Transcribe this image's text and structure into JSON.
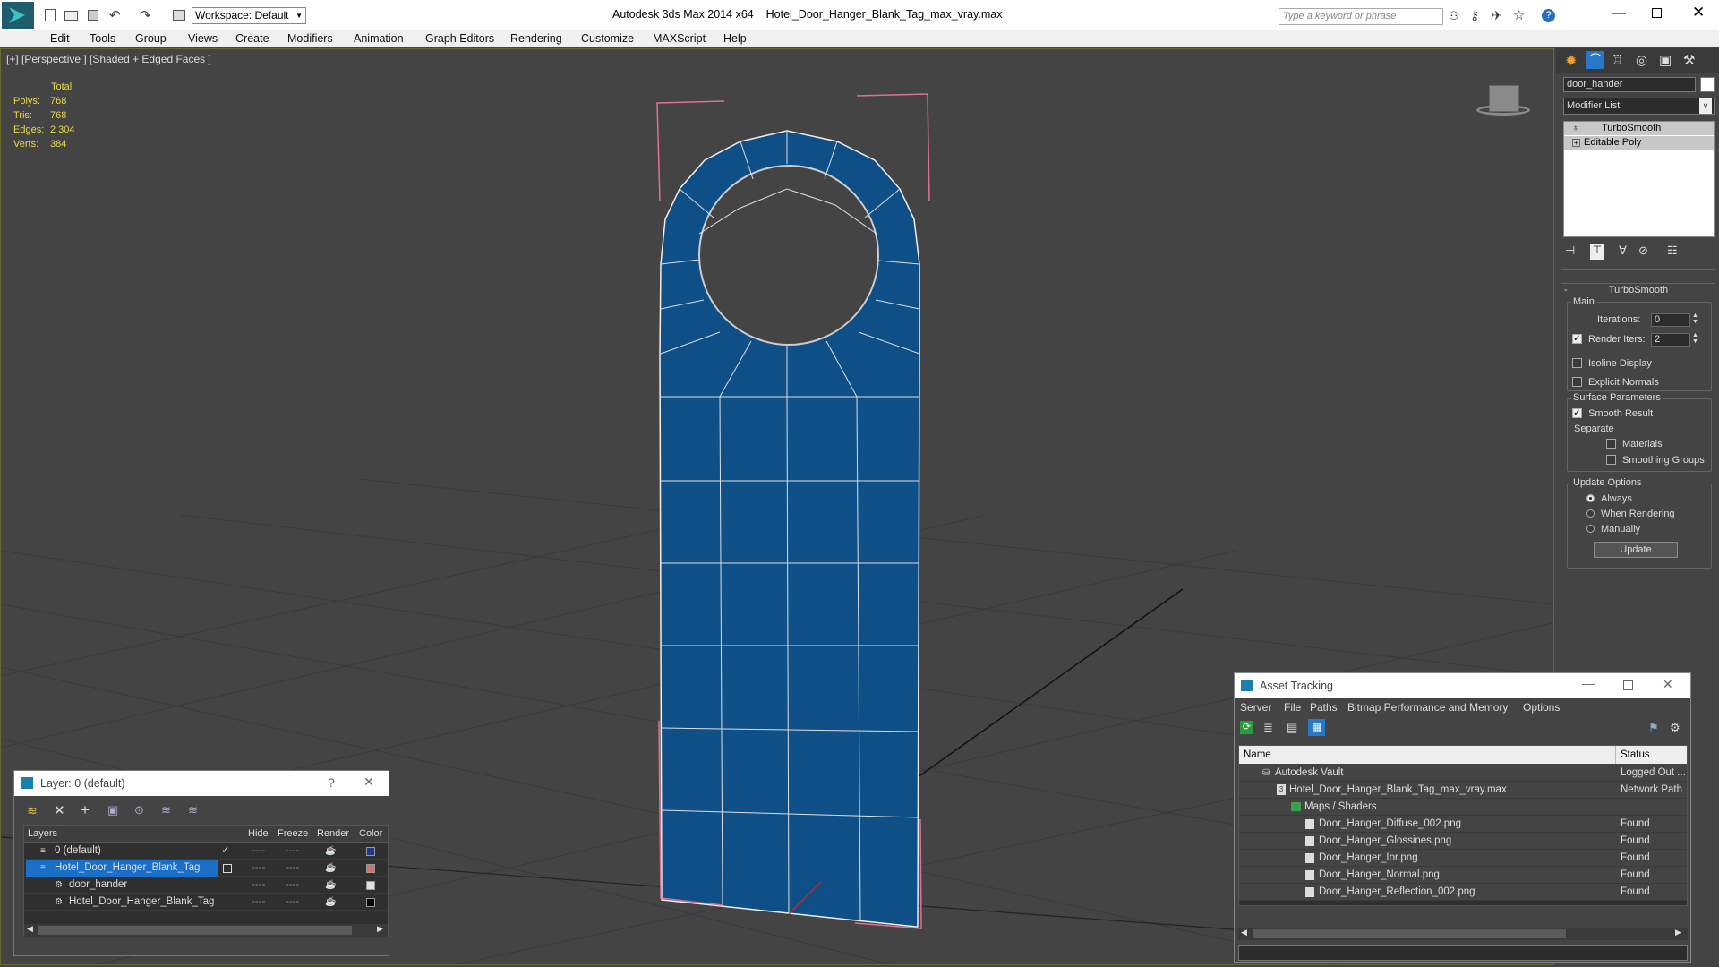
{
  "app": {
    "title": "Autodesk 3ds Max  2014 x64",
    "file": "Hotel_Door_Hanger_Blank_Tag_max_vray.max",
    "workspace": "Workspace: Default",
    "search_placeholder": "Type a keyword or phrase"
  },
  "menu": [
    "Edit",
    "Tools",
    "Group",
    "Views",
    "Create",
    "Modifiers",
    "Animation",
    "Graph Editors",
    "Rendering",
    "Customize",
    "MAXScript",
    "Help"
  ],
  "viewport": {
    "label": "[+] [Perspective ] [Shaded + Edged Faces ]",
    "stats": {
      "header": "Total",
      "polys_label": "Polys:",
      "polys": "768",
      "tris_label": "Tris:",
      "tris": "768",
      "edges_label": "Edges:",
      "edges": "2 304",
      "verts_label": "Verts:",
      "verts": "384"
    }
  },
  "command_panel": {
    "object_name": "door_hander",
    "modifier_list": "Modifier List",
    "stack": [
      "TurboSmooth",
      "Editable Poly"
    ],
    "rollout": {
      "title": "TurboSmooth",
      "main": "Main",
      "iterations_label": "Iterations:",
      "iterations": "0",
      "render_iters_label": "Render Iters:",
      "render_iters": "2",
      "render_iters_checked": true,
      "isoline": "Isoline Display",
      "explicit": "Explicit Normals",
      "surface": "Surface Parameters",
      "smooth_result": "Smooth Result",
      "separate": "Separate",
      "materials": "Materials",
      "smoothing_groups": "Smoothing Groups",
      "update_options": "Update Options",
      "always": "Always",
      "when_rendering": "When Rendering",
      "manually": "Manually",
      "update_button": "Update"
    }
  },
  "layer_window": {
    "title": "Layer: 0 (default)",
    "help": "?",
    "columns": [
      "Layers",
      "Hide",
      "Freeze",
      "Render",
      "Color"
    ],
    "rows": [
      {
        "name": "0 (default)",
        "color": "#1a3a8a"
      },
      {
        "name": "Hotel_Door_Hanger_Blank_Tag",
        "color": "#d87070"
      },
      {
        "name": "door_hander",
        "color": "#e0e0e0"
      },
      {
        "name": "Hotel_Door_Hanger_Blank_Tag",
        "color": "#000000"
      }
    ]
  },
  "asset_window": {
    "title": "Asset Tracking",
    "menu": [
      "Server",
      "File",
      "Paths",
      "Bitmap Performance and Memory",
      "Options"
    ],
    "columns": [
      "Name",
      "Status"
    ],
    "rows": [
      {
        "name": "Autodesk Vault",
        "status": "Logged Out ..."
      },
      {
        "name": "Hotel_Door_Hanger_Blank_Tag_max_vray.max",
        "status": "Network Path"
      },
      {
        "name": "Maps / Shaders",
        "status": ""
      },
      {
        "name": "Door_Hanger_Diffuse_002.png",
        "status": "Found"
      },
      {
        "name": "Door_Hanger_Glossines.png",
        "status": "Found"
      },
      {
        "name": "Door_Hanger_Ior.png",
        "status": "Found"
      },
      {
        "name": "Door_Hanger_Normal.png",
        "status": "Found"
      },
      {
        "name": "Door_Hanger_Reflection_002.png",
        "status": "Found"
      }
    ]
  },
  "colors": {
    "accent": "#1e90d0",
    "mesh": "#0d4f86",
    "selection": "#e07090",
    "stats": "#e8d84a"
  }
}
